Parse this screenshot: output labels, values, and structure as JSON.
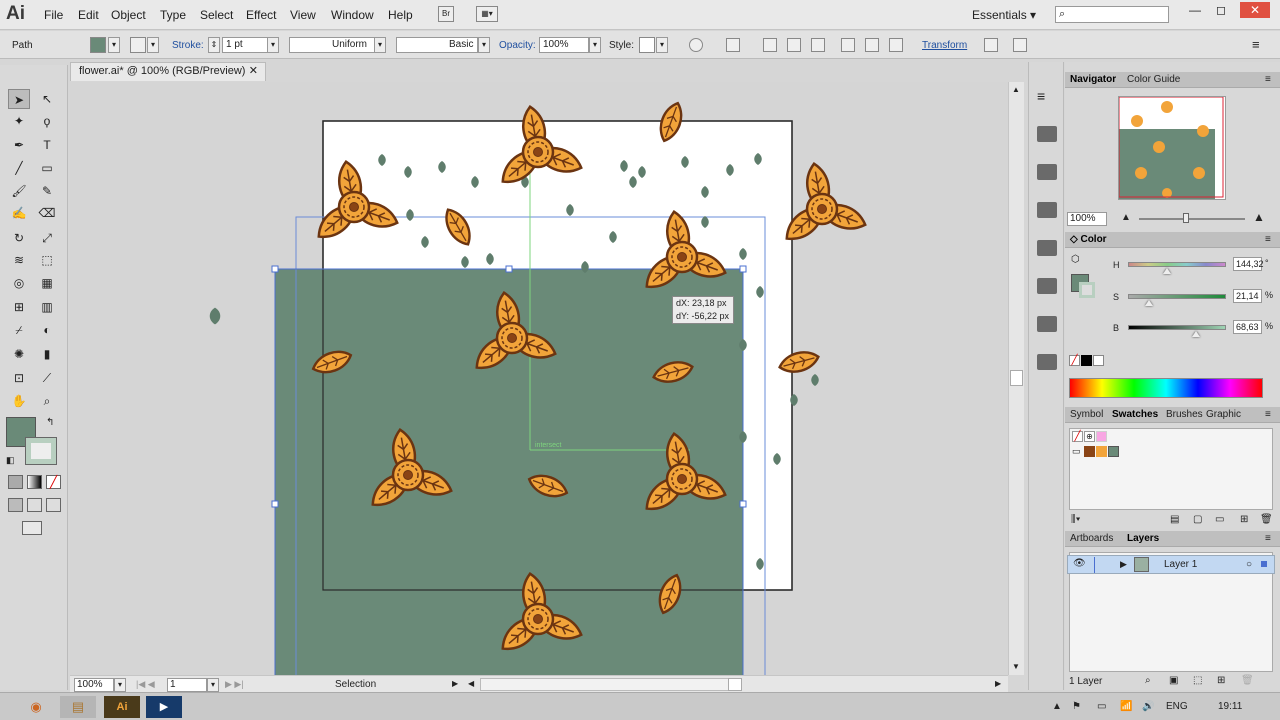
{
  "app": {
    "logo": "Ai",
    "menu": [
      "File",
      "Edit",
      "Object",
      "Type",
      "Select",
      "Effect",
      "View",
      "Window",
      "Help"
    ],
    "workspace": "Essentials",
    "search_placeholder": "",
    "window_buttons": [
      "—",
      "◻",
      "✕"
    ]
  },
  "control": {
    "object_type": "Path",
    "stroke_label": "Stroke:",
    "stroke_weight": "1 pt",
    "profile": "Uniform",
    "brush": "Basic",
    "opacity_label": "Opacity:",
    "opacity_value": "100%",
    "style_label": "Style:",
    "transform_label": "Transform"
  },
  "document": {
    "tab_title": "flower.ai* @ 100% (RGB/Preview)",
    "close": "✕"
  },
  "canvas": {
    "tooltip_dx": "dX: 23,18 px",
    "tooltip_dy": "dY: -56,22 px",
    "smart_guide": "intersect"
  },
  "status": {
    "zoom": "100%",
    "artboard": "1",
    "mode": "Selection"
  },
  "navigator": {
    "tabs": [
      "Navigator",
      "Color Guide"
    ],
    "zoom": "100%"
  },
  "color": {
    "title": "Color",
    "sliders": [
      {
        "label": "H",
        "value": "144,32",
        "unit": "°",
        "level": 0.4
      },
      {
        "label": "S",
        "value": "21,14",
        "unit": "%",
        "level": 0.21
      },
      {
        "label": "B",
        "value": "68,63",
        "unit": "%",
        "level": 0.69
      }
    ]
  },
  "swatches": {
    "tabs": [
      "Symbol",
      "Swatches",
      "Brushes",
      "Graphic"
    ]
  },
  "layers": {
    "tabs": [
      "Artboards",
      "Layers"
    ],
    "layer_name": "Layer 1",
    "count": "1 Layer"
  },
  "taskbar": {
    "lang": "ENG",
    "time": "19:11"
  },
  "colors": {
    "fill": "#6a8a78",
    "petal": "#f2a43a",
    "petal_stroke": "#6b3411",
    "leaf": "#5f7d6c"
  }
}
